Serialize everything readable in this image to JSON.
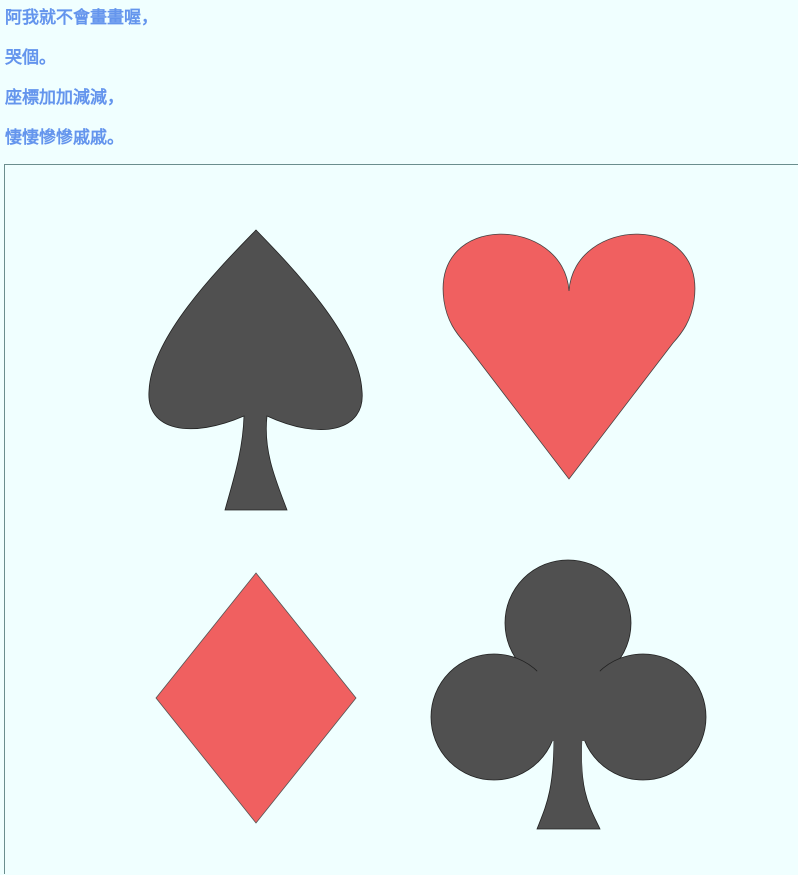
{
  "text_lines": [
    "阿我就不會畫畫喔，",
    "哭個。",
    "座標加加減減，",
    "悽悽慘慘戚戚。"
  ],
  "cards": {
    "spade": {
      "fill": "#505050",
      "stroke": "#222222"
    },
    "heart": {
      "fill": "#f06060",
      "stroke": "#444444"
    },
    "diamond": {
      "fill": "#f06060",
      "stroke": "#555555"
    },
    "club": {
      "fill": "#505050",
      "stroke": "#222222"
    }
  },
  "colors": {
    "background": "#f0ffff",
    "text": "#6495ed",
    "canvas_border": "#6b8e8e"
  }
}
